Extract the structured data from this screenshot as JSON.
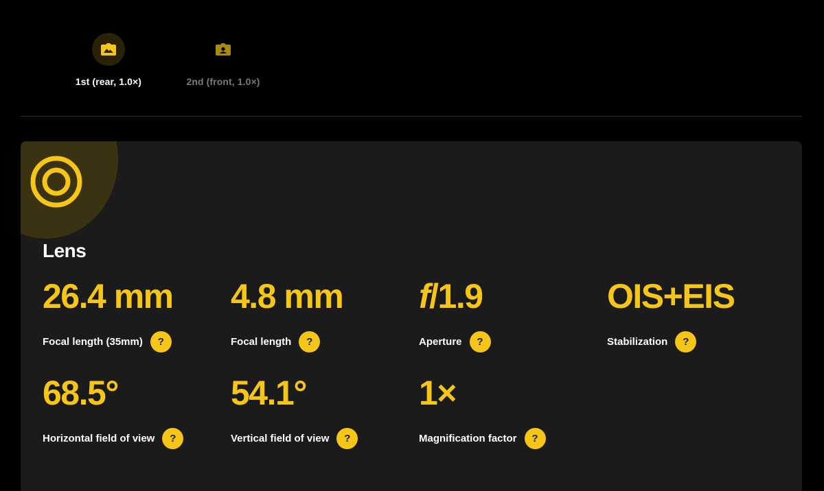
{
  "tabs": [
    {
      "label": "1st (rear, 1.0×)",
      "icon": "camera-rear-icon",
      "active": true
    },
    {
      "label": "2nd (front, 1.0×)",
      "icon": "camera-front-icon",
      "active": false
    }
  ],
  "card": {
    "title": "Lens",
    "icon": "lens-icon",
    "help_symbol": "?",
    "specs": [
      {
        "value": "26.4 mm",
        "label": "Focal length (35mm)"
      },
      {
        "value": "4.8 mm",
        "label": "Focal length"
      },
      {
        "value_prefix": "f",
        "value": "/1.9",
        "label": "Aperture"
      },
      {
        "value": "OIS+EIS",
        "label": "Stabilization"
      },
      {
        "value": "68.5°",
        "label": "Horizontal field of view"
      },
      {
        "value": "54.1°",
        "label": "Vertical field of view"
      },
      {
        "value": "1×",
        "label": "Magnification factor"
      }
    ]
  },
  "colors": {
    "accent": "#f5c518",
    "background": "#000000",
    "card": "#1b1b1b",
    "inactive_text": "#7a7a7a"
  }
}
